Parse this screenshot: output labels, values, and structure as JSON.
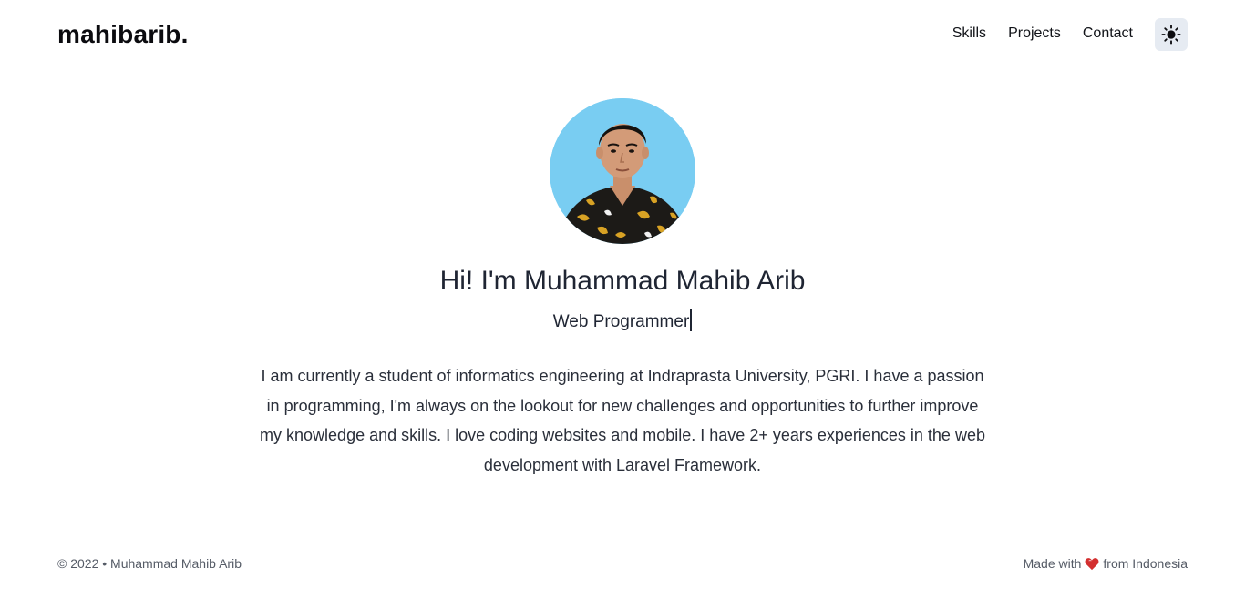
{
  "header": {
    "brand": "mahibarib.",
    "nav": [
      {
        "label": "Skills"
      },
      {
        "label": "Projects"
      },
      {
        "label": "Contact"
      }
    ],
    "theme_toggle_icon": "sun-icon"
  },
  "hero": {
    "avatar_icon": "profile-photo",
    "title": "Hi! I'm Muhammad Mahib Arib",
    "subtitle": "Web Programmer",
    "bio": "I am currently a student of informatics engineering at Indraprasta University, PGRI. I have a passion in programming, I'm always on the lookout for new challenges and opportunities to further improve my knowledge and skills. I love coding websites and mobile. I have 2+ years experiences in the web development with Laravel Framework."
  },
  "footer": {
    "copyright": "© 2022 • Muhammad Mahib Arib",
    "made_with_prefix": "Made with",
    "made_with_suffix": "from Indonesia",
    "heart_icon": "heart-icon"
  },
  "colors": {
    "toggle_bg": "#e6ebf2",
    "avatar_bg": "#79cdf2",
    "heart": "#d32f2f"
  }
}
